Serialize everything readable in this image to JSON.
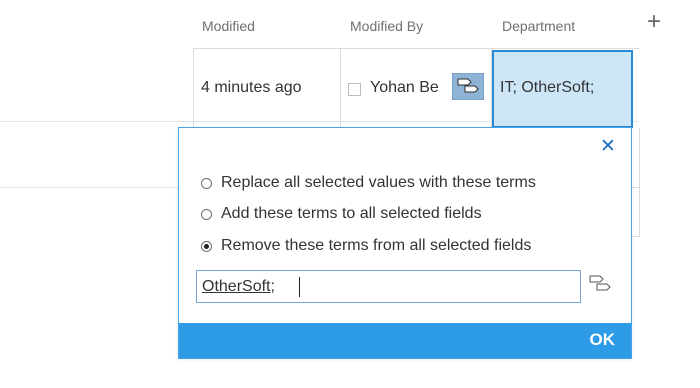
{
  "header": {
    "modified": "Modified",
    "modified_by": "Modified By",
    "department": "Department",
    "add_column": "+"
  },
  "row": {
    "modified": "4 minutes ago",
    "modified_by": "Yohan Be",
    "department": "IT; OtherSoft;"
  },
  "dialog": {
    "close": "✕",
    "options": [
      {
        "label": "Replace all selected values with these terms",
        "checked": false
      },
      {
        "label": "Add these terms to all selected fields",
        "checked": false
      },
      {
        "label": "Remove these terms from all selected fields",
        "checked": true
      }
    ],
    "input_value": "OtherSoft;",
    "ok_label": "OK"
  },
  "colors": {
    "accent": "#2d9be5",
    "selection_fill": "#cde6f7",
    "selection_border": "#2a8ad4",
    "close_icon": "#1f6fc0"
  },
  "icons": {
    "term_picker": "tag-icon",
    "close": "close-icon",
    "add_column": "plus-icon"
  }
}
